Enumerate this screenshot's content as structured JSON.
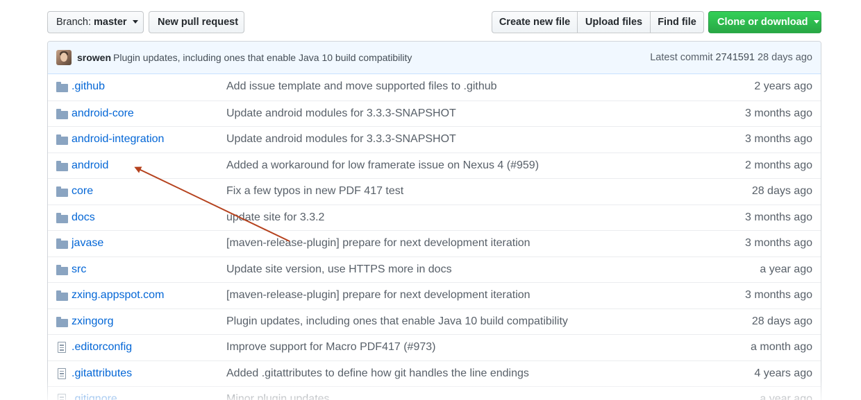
{
  "toolbar": {
    "branch_prefix": "Branch:",
    "branch_name": "master",
    "new_pr": "New pull request",
    "create_file": "Create new file",
    "upload_files": "Upload files",
    "find_file": "Find file",
    "clone": "Clone or download"
  },
  "commit": {
    "author": "srowen",
    "message": "Plugin updates, including ones that enable Java 10 build compatibility",
    "latest_label": "Latest commit",
    "sha": "2741591",
    "age": "28 days ago"
  },
  "files": [
    {
      "type": "folder",
      "name": ".github",
      "message": "Add issue template and move supported files to .github",
      "age": "2 years ago"
    },
    {
      "type": "folder",
      "name": "android-core",
      "message": "Update android modules for 3.3.3-SNAPSHOT",
      "age": "3 months ago"
    },
    {
      "type": "folder",
      "name": "android-integration",
      "message": "Update android modules for 3.3.3-SNAPSHOT",
      "age": "3 months ago"
    },
    {
      "type": "folder",
      "name": "android",
      "message": "Added a workaround for low framerate issue on Nexus 4 (#959)",
      "age": "2 months ago"
    },
    {
      "type": "folder",
      "name": "core",
      "message": "Fix a few typos in new PDF 417 test",
      "age": "28 days ago"
    },
    {
      "type": "folder",
      "name": "docs",
      "message": "update site for 3.3.2",
      "age": "3 months ago"
    },
    {
      "type": "folder",
      "name": "javase",
      "message": "[maven-release-plugin] prepare for next development iteration",
      "age": "3 months ago"
    },
    {
      "type": "folder",
      "name": "src",
      "message": "Update site version, use HTTPS more in docs",
      "age": "a year ago"
    },
    {
      "type": "folder",
      "name": "zxing.appspot.com",
      "message": "[maven-release-plugin] prepare for next development iteration",
      "age": "3 months ago"
    },
    {
      "type": "folder",
      "name": "zxingorg",
      "message": "Plugin updates, including ones that enable Java 10 build compatibility",
      "age": "28 days ago"
    },
    {
      "type": "file",
      "name": ".editorconfig",
      "message": "Improve support for Macro PDF417 (#973)",
      "age": "a month ago"
    },
    {
      "type": "file",
      "name": ".gitattributes",
      "message": "Added .gitattributes to define how git handles the line endings",
      "age": "4 years ago"
    },
    {
      "type": "file",
      "name": ".gitignore",
      "message": "Minor plugin updates",
      "age": "a year ago"
    }
  ],
  "colors": {
    "link": "#0366d6",
    "clone_green": "#28a745",
    "commit_bg": "#f1f8ff",
    "annotation_arrow": "#b5421e"
  },
  "annotation": {
    "icon": "arrow-annotation",
    "color": "#b5421e"
  }
}
